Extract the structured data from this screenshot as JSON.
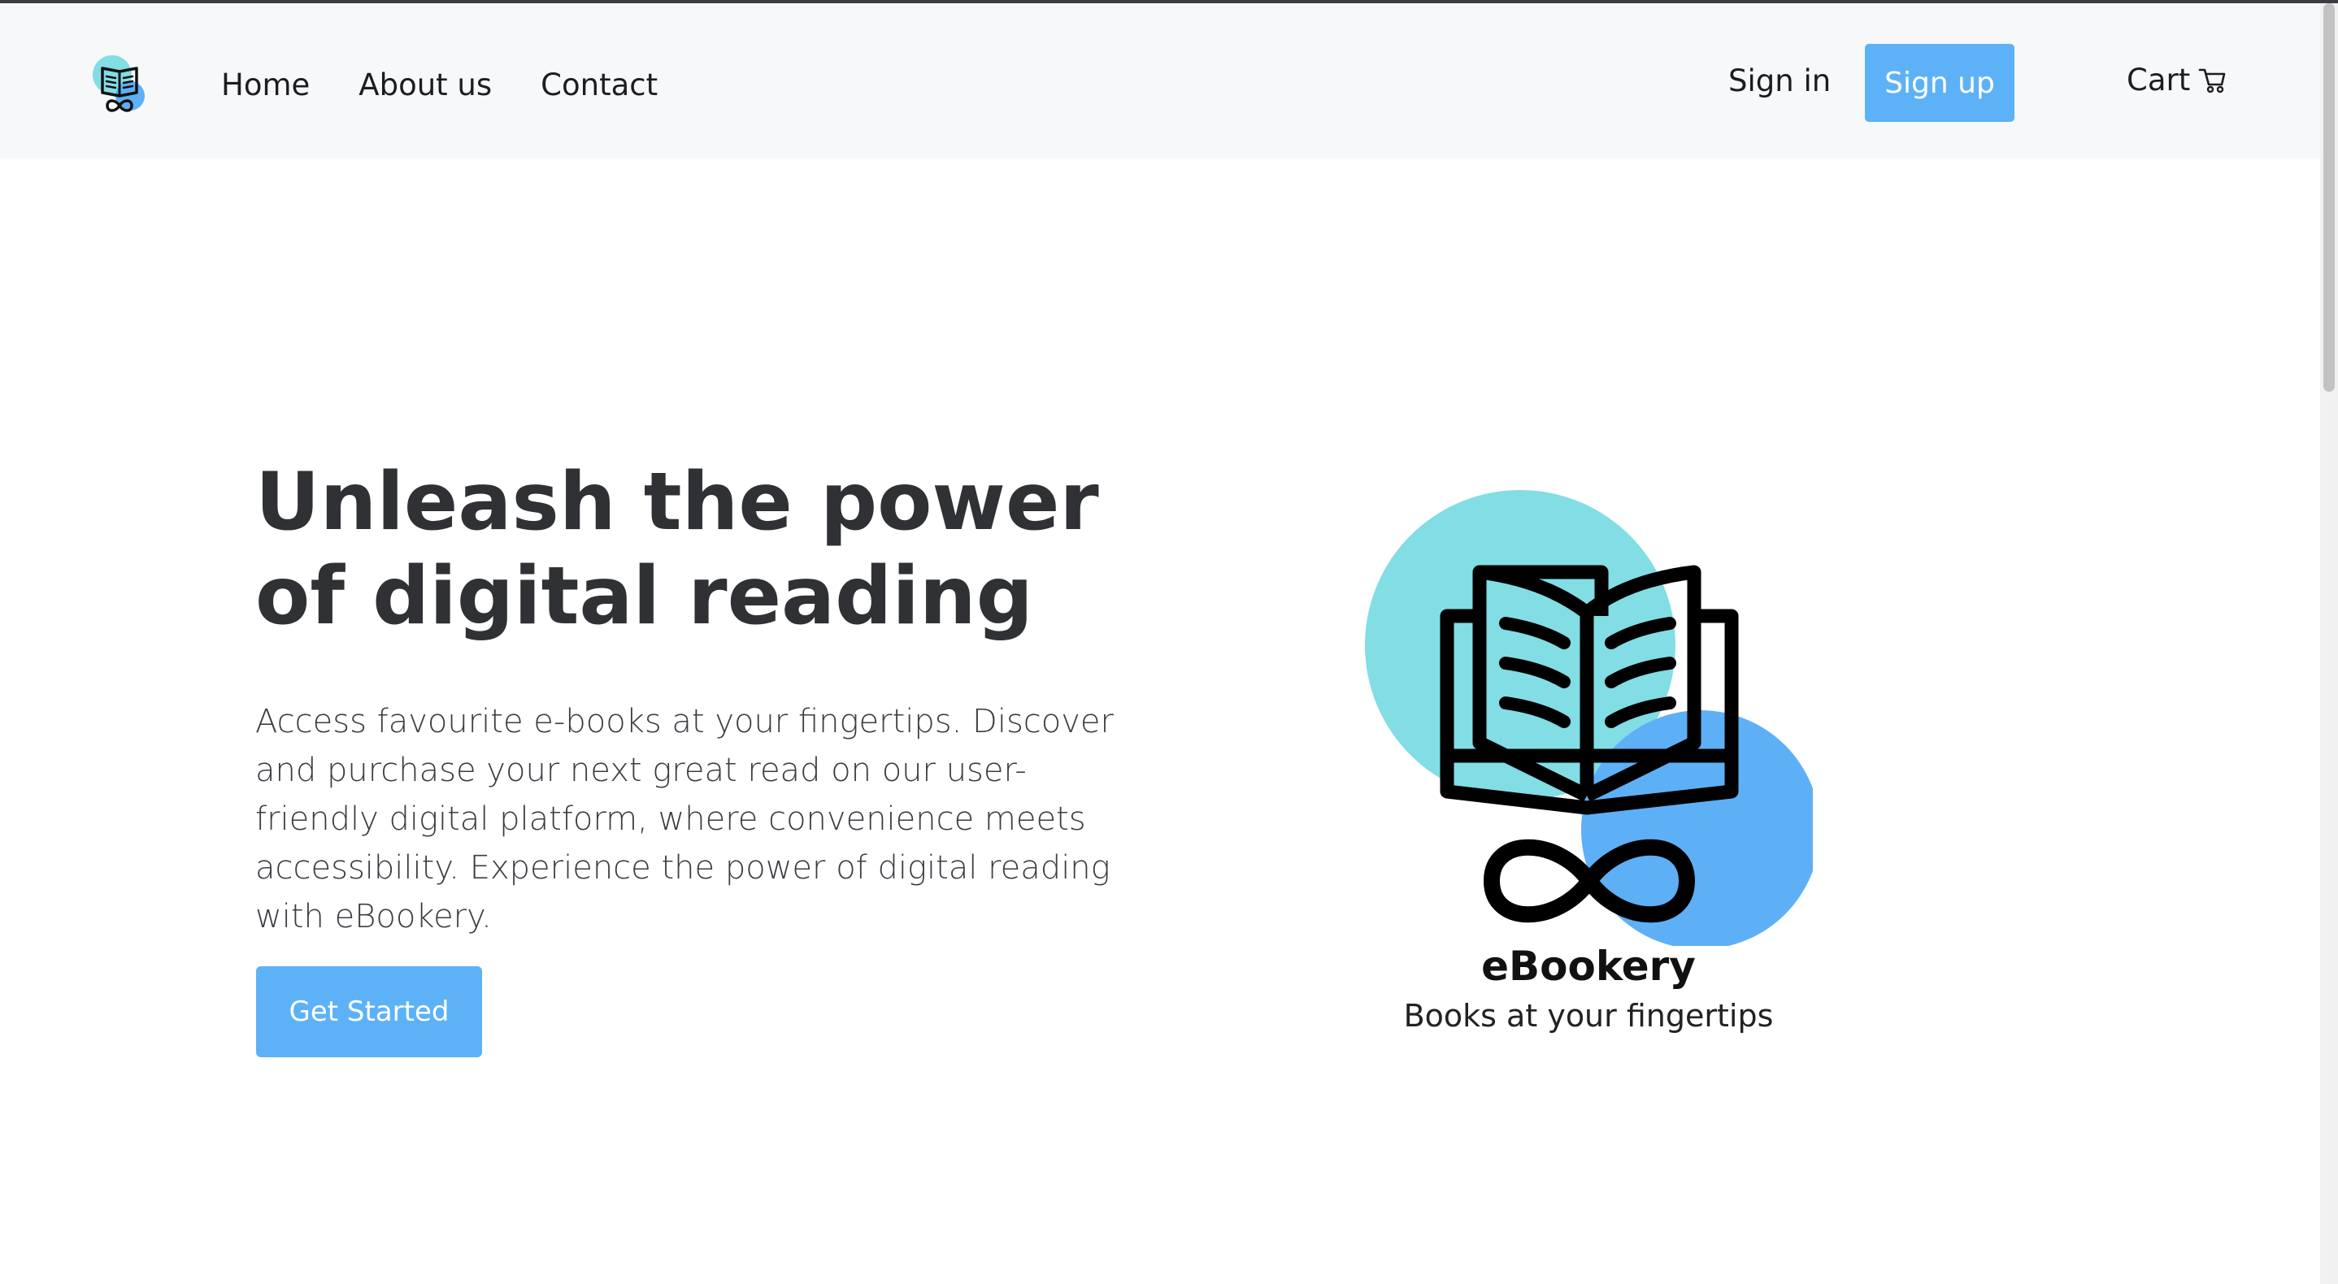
{
  "nav": {
    "links": [
      "Home",
      "About us",
      "Contact"
    ],
    "sign_in": "Sign in",
    "sign_up": "Sign up",
    "cart_label": "Cart",
    "cart_icon": "shopping-cart-icon",
    "logo_icon": "ebookery-logo-icon"
  },
  "hero": {
    "title": "Unleash the power of digital reading",
    "description": "Access favourite e-books at your fingertips. Discover and purchase your next great read on our user-friendly digital platform, where convenience meets accessibility. Experience the power of digital reading with eBookery.",
    "cta_label": "Get Started"
  },
  "brand": {
    "name": "eBookery",
    "tagline": "Books at your fingertips"
  },
  "colors": {
    "accent": "#5db2f7",
    "teal": "#82dde4",
    "blue_circle": "#5eb0f6",
    "navbar_bg": "#f7f8fa",
    "heading": "#2f3135"
  }
}
